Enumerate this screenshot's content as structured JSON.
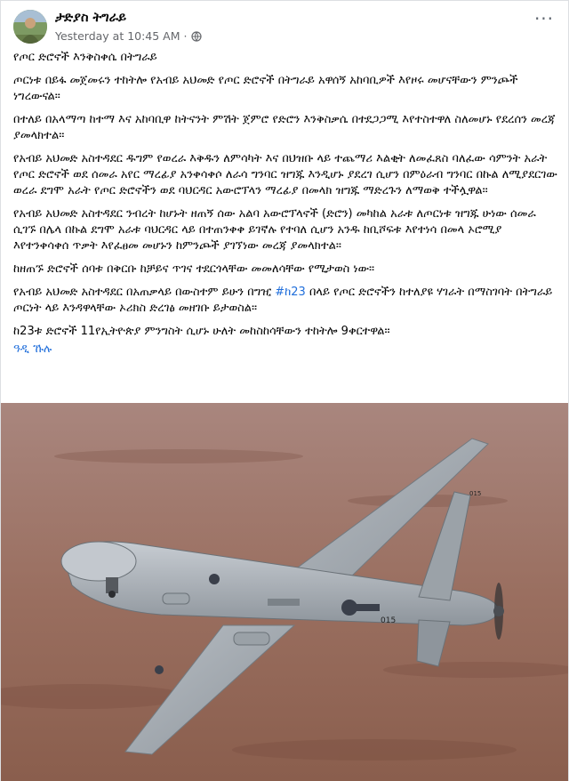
{
  "post": {
    "author": "ታድያስ ትግራይ",
    "timestamp": "Yesterday at 10:45 AM",
    "separator": "·",
    "more_label": "···",
    "paragraphs": [
      "የጦር ድሮኖች እንቅስቀሴ በትግራይ",
      "ጦርነቱ በይፋ መጀመሩን ተከትሎ የአብይ አህመድ የጦር ድሮኖች በትግራይ አዋሰኝ አከባቢዎች እየዞሩ መሆናቸውን ምንጮች ነግረውናል።",
      "በተለይ በአላማጣ ከተማ እና አከባቢዋ ከትናንት ምሽት ጀምሮ የድሮን እንቅስቃሴ በተደጋጋሚ እየተስተዋለ ስለመሆኑ የደረሰን መረጃ ያመላክተል።",
      "የአብይ አህመድ አስተዳደር ዱግም የወረራ እቅዱን ለምሳካት እና በህዝቡ ላይ ተጨማሪ እልቂት ለመፈጸስ ባለፈው ሳምንት አራት የጦር ድሮኖች ወደ ሰመራ አየር ማረፊያ አንቀሳቀሶ ለራሳ ግንባር ዝግጁ እንዲሆኑ ያደረገ ሲሆን በምዕራብ ግንባር በኩል ለሚያደርገው ወረራ ደግሞ አራት የጦር ድሮኖችን ወደ ባህርዳር አውሮፕላን ማረፊያ በመላክ ዝግጁ ማድረጉን ለማወቅ ተችሏዋል።",
      "የአብይ አህመድ አስተዳደር ንብረት ከሆኑት ዘጠኝ ሰው አልባ አውሮፕላኖች (ድሮን) መካከል አራቱ ለጦርነቱ ዝግጁ ሁነው ሰመራ ሲገኙ በሌላ በኩል ደግሞ አራቱ ባህርዳር ላይ በተጠንቀቀ ይገኛሉ የተባለ ሲሆን አንዱ ከቢሾፍቱ እየተነሳ በመላ ኦሮሚያ እየተንቀሳቀሰ ጥቃት እየፈፀመ መሆኑን ከምንጮች ያገኘነው መረጃ ያመላክተል።",
      "ከዘጠኙ ድሮኖች ሰባቱ በቅርቡ ከቻይና ጥገና ተደርጎላቸው መመለሳቸው የሚታወስ ነው።"
    ],
    "para_hashtag": {
      "before": "የአብይ አህመድ አስተዳደር በአጠቃላይ በውስተም ይሁን በግዢ ",
      "hashtag": "#ከ23",
      "after": " በላይ የጦር ድሮኖችን ከተለያዩ ሃገራት በማስገባት በትግራይ ጦርነት ላይ እንዳዋላቸው ኦሪክስ ድረገፅ መዘገቡ ይታወስል።"
    },
    "last_line": "ከ23ቱ ድሮኖች  11የኢትዮጵያ ምንግስት ሲሆኑ ሁለት መከስከሳቸውን ተከትሎ 9ቀርተዋል።",
    "see_more": "ዓዲ ኹሉ",
    "photo_tail_number": "015",
    "colors": {
      "link": "#216fdb",
      "meta": "#65676b",
      "sky": "#8a5e4d"
    }
  }
}
